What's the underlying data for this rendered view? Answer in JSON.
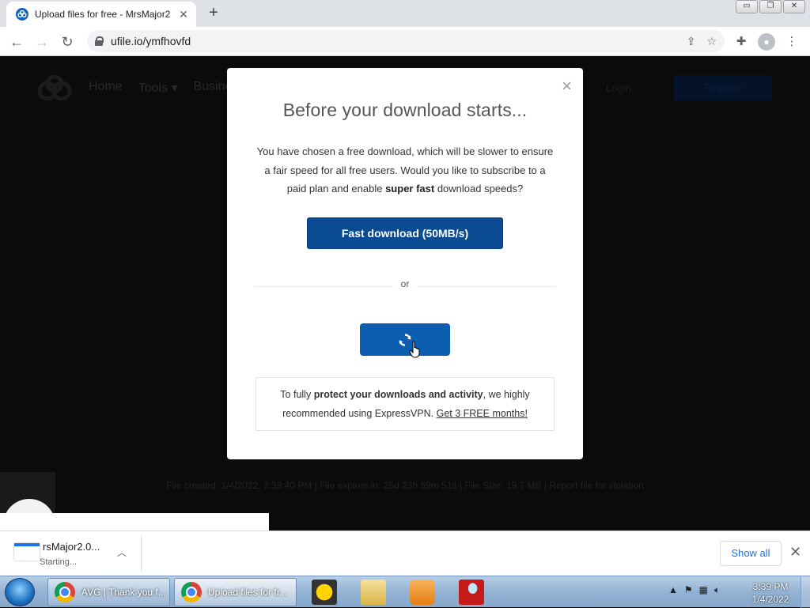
{
  "browser": {
    "tab_title": "Upload files for free - MrsMajor2",
    "tab_close": "✕",
    "new_tab": "+",
    "url": "ufile.io/ymfhovfd",
    "window_controls": [
      "▭",
      "❐",
      "✕"
    ]
  },
  "site": {
    "nav": [
      "Home",
      "Tools ▾",
      "Busine"
    ],
    "login": "Login",
    "register": "Register",
    "file_info": "File created: 1/4/2022, 3:39:40 PM   |   File expires in: 25d 23h 59m 51s   |   File Size: 19.7 MB   |   Report file for violation"
  },
  "modal": {
    "close": "×",
    "title": "Before your download starts...",
    "text_part1": "You have chosen a free download, which will be slower to ensure a fair speed for all free users. Would you like to subscribe to a paid plan and enable ",
    "text_bold": "super fast",
    "text_part2": " download speeds?",
    "fast_button": "Fast download (50MB/s)",
    "or": "or",
    "vpn_part1": "To fully ",
    "vpn_bold": "protect your downloads and activity",
    "vpn_part2": ", we highly recommended using ExpressVPN. ",
    "vpn_link": "Get 3 FREE months!"
  },
  "download_bar": {
    "file_name": "rsMajor2.0...",
    "status": "Starting...",
    "show_all": "Show all",
    "close": "✕"
  },
  "taskbar": {
    "tasks": [
      {
        "label": "AVG | Thank you f..."
      },
      {
        "label": "Upload files for fr..."
      }
    ],
    "time": "3:39 PM",
    "date": "1/4/2022",
    "tray_arrow": "▲"
  },
  "colors": {
    "primary_button": "#0a4b94",
    "secondary_button": "#0d5db1",
    "link": "#1a73e8"
  }
}
